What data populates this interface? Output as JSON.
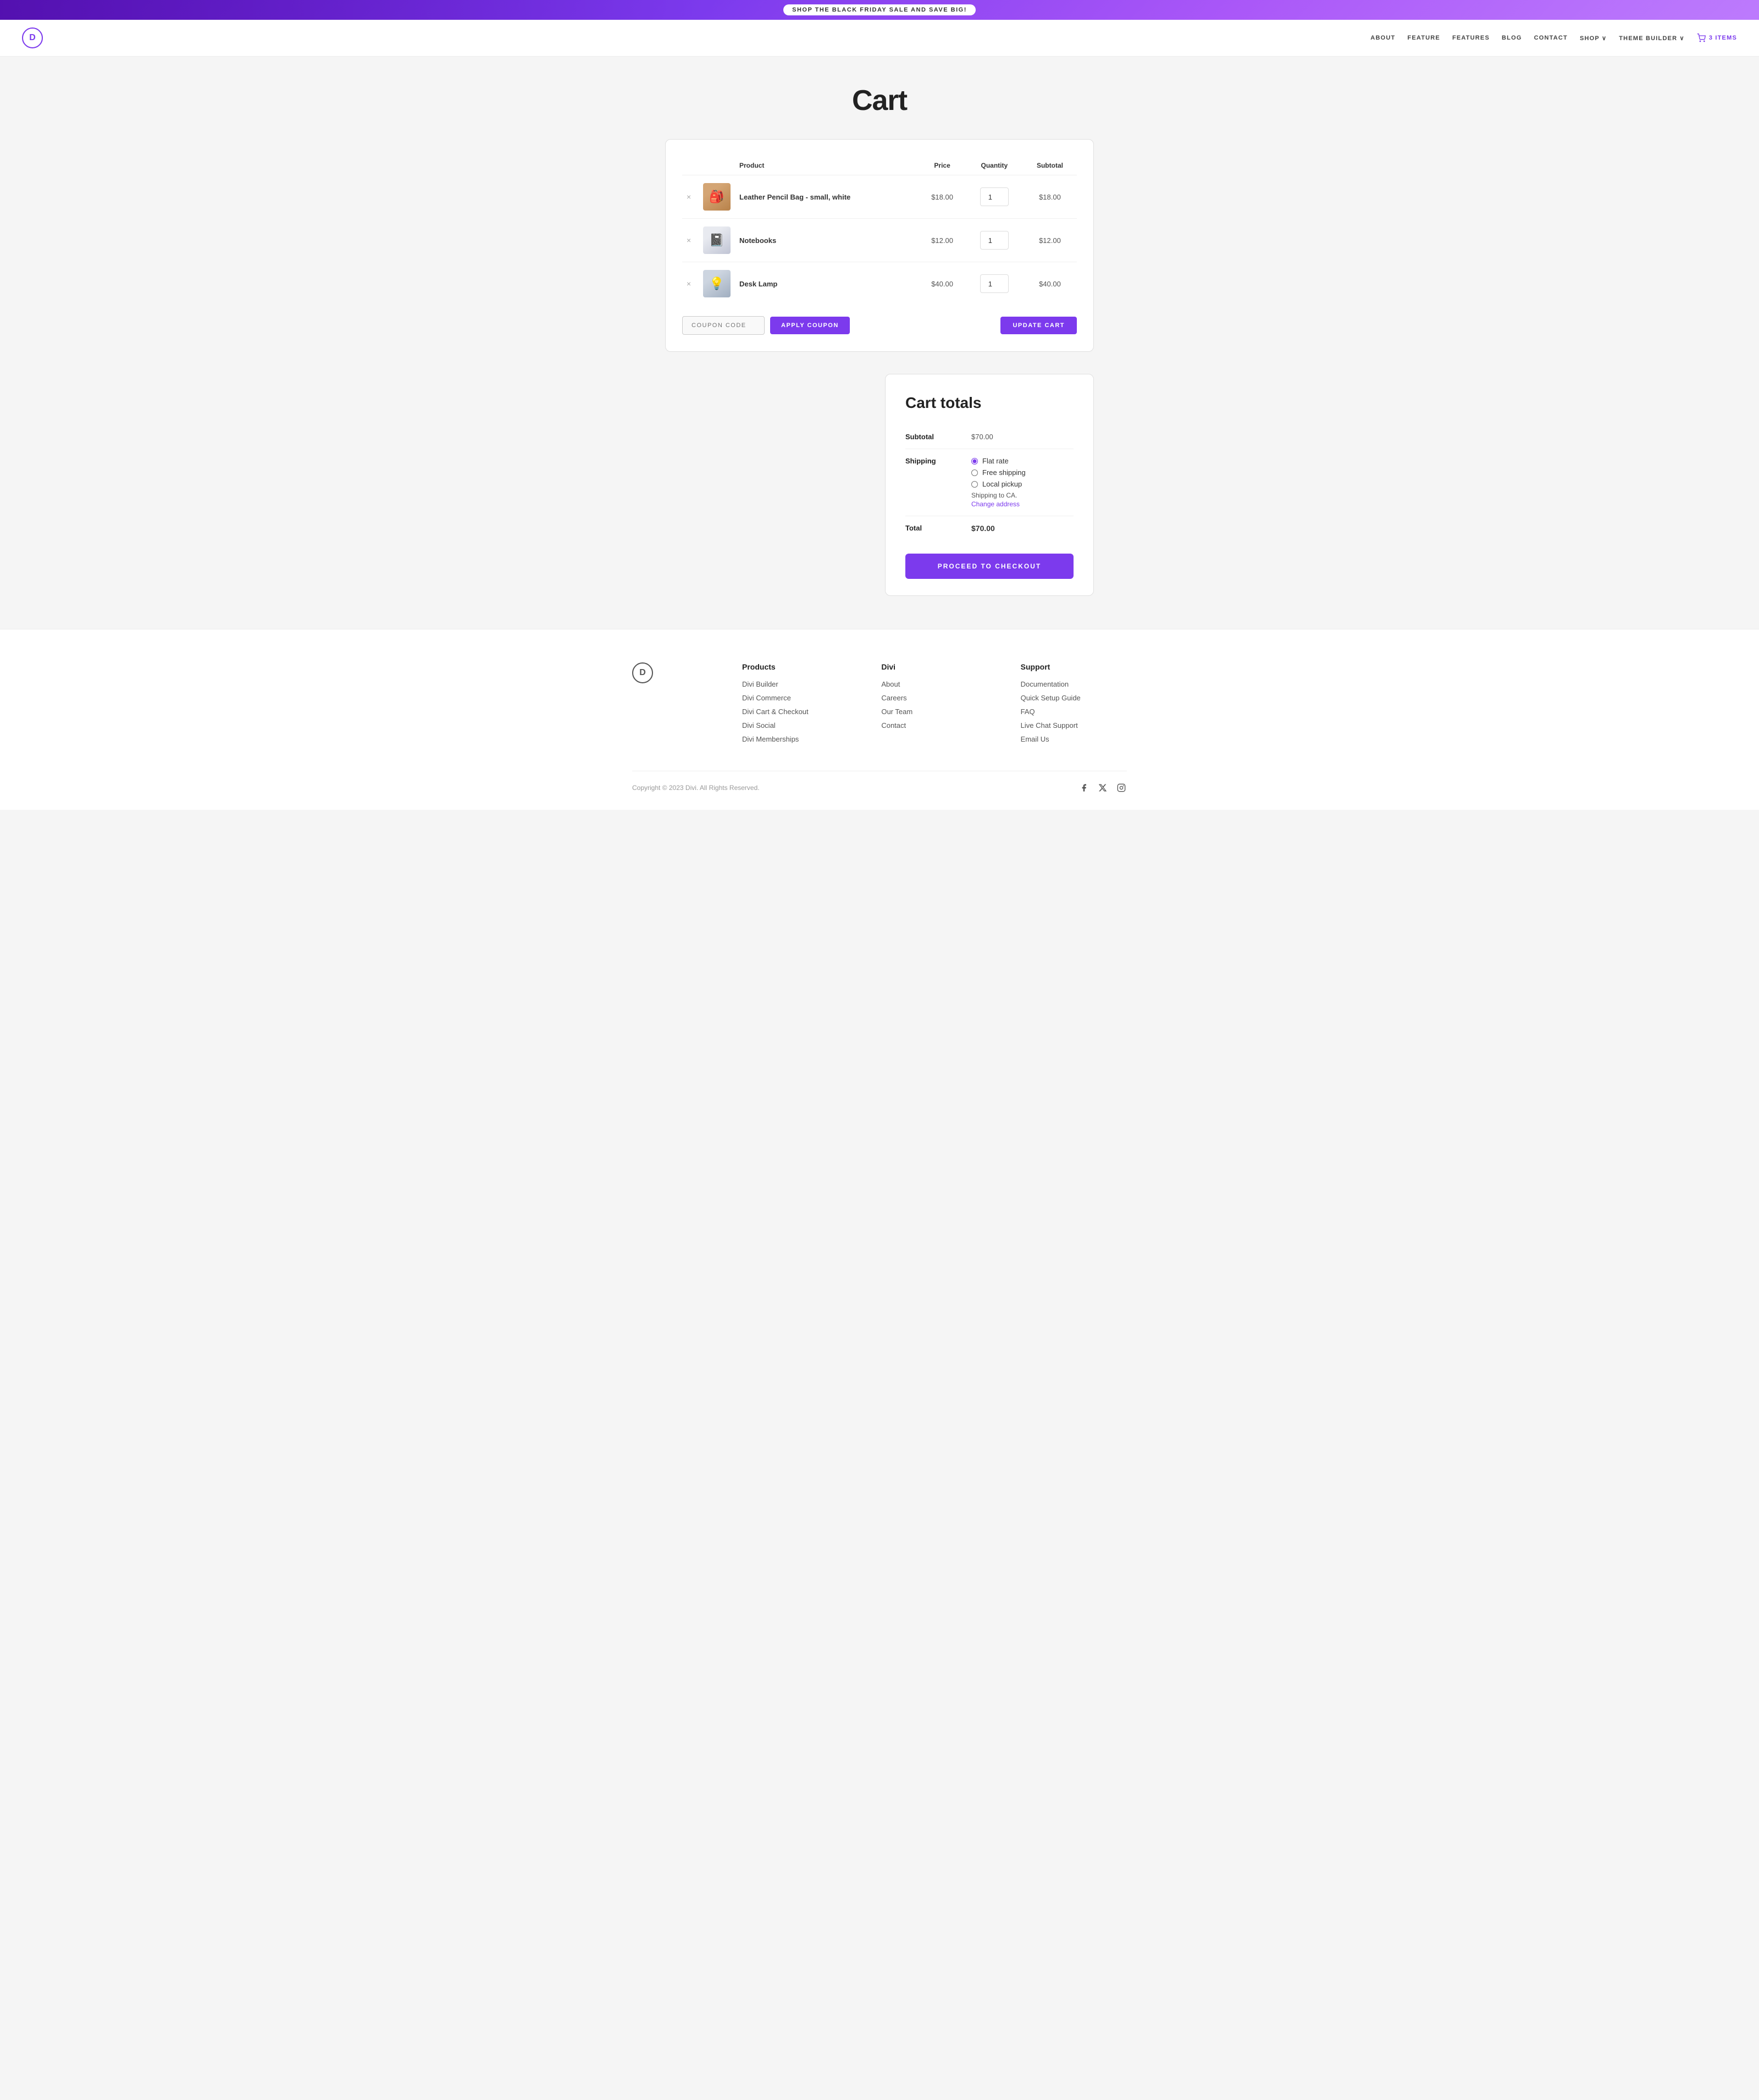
{
  "banner": {
    "text": "SHOP THE BLACK FRIDAY SALE AND SAVE BIG!"
  },
  "header": {
    "logo_letter": "D",
    "nav": [
      {
        "label": "ABOUT",
        "id": "about"
      },
      {
        "label": "FEATURE",
        "id": "feature"
      },
      {
        "label": "FEATURES",
        "id": "features"
      },
      {
        "label": "BLOG",
        "id": "blog"
      },
      {
        "label": "CONTACT",
        "id": "contact"
      },
      {
        "label": "SHOP",
        "id": "shop"
      },
      {
        "label": "THEME BUILDER",
        "id": "theme-builder"
      }
    ],
    "cart_label": "3 ITEMS"
  },
  "page": {
    "title": "Cart"
  },
  "cart": {
    "columns": {
      "product": "Product",
      "price": "Price",
      "quantity": "Quantity",
      "subtotal": "Subtotal"
    },
    "items": [
      {
        "id": "pencilbag",
        "name": "Leather Pencil Bag - small, white",
        "price": "$18.00",
        "quantity": "1",
        "subtotal": "$18.00"
      },
      {
        "id": "notebooks",
        "name": "Notebooks",
        "price": "$12.00",
        "quantity": "1",
        "subtotal": "$12.00"
      },
      {
        "id": "desklamp",
        "name": "Desk Lamp",
        "price": "$40.00",
        "quantity": "1",
        "subtotal": "$40.00"
      }
    ],
    "coupon_placeholder": "COUPON CODE",
    "apply_coupon_label": "APPLY COUPON",
    "update_cart_label": "UPDATE CART"
  },
  "cart_totals": {
    "title": "Cart totals",
    "subtotal_label": "Subtotal",
    "subtotal_value": "$70.00",
    "shipping_label": "Shipping",
    "shipping_options": [
      {
        "label": "Flat rate",
        "selected": true
      },
      {
        "label": "Free shipping",
        "selected": false
      },
      {
        "label": "Local pickup",
        "selected": false
      }
    ],
    "shipping_to_text": "Shipping to CA.",
    "change_address_label": "Change address",
    "total_label": "Total",
    "total_value": "$70.00",
    "checkout_label": "PROCEED TO CHECKOUT"
  },
  "footer": {
    "logo_letter": "D",
    "columns": [
      {
        "title": "Products",
        "links": [
          "Divi Builder",
          "Divi Commerce",
          "Divi Cart & Checkout",
          "Divi Social",
          "Divi Memberships"
        ]
      },
      {
        "title": "Divi",
        "links": [
          "About",
          "Careers",
          "Our Team",
          "Contact"
        ]
      },
      {
        "title": "Support",
        "links": [
          "Documentation",
          "Quick Setup Guide",
          "FAQ",
          "Live Chat Support",
          "Email Us"
        ]
      }
    ],
    "copyright": "Copyright © 2023 Divi. All Rights Reserved.",
    "social": [
      {
        "name": "facebook",
        "icon": "f"
      },
      {
        "name": "twitter-x",
        "icon": "𝕏"
      },
      {
        "name": "instagram",
        "icon": "◎"
      }
    ]
  }
}
